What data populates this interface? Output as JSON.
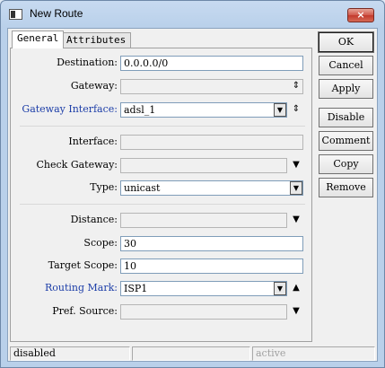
{
  "window": {
    "title": "New Route",
    "close_icon": "×"
  },
  "tabs": [
    {
      "label": "General"
    },
    {
      "label": "Attributes"
    }
  ],
  "fields": {
    "destination": {
      "label": "Destination:",
      "value": "0.0.0.0/0"
    },
    "gateway": {
      "label": "Gateway:",
      "value": ""
    },
    "gateway_interface": {
      "label": "Gateway Interface:",
      "value": "adsl_1"
    },
    "interface": {
      "label": "Interface:",
      "value": ""
    },
    "check_gateway": {
      "label": "Check Gateway:",
      "value": ""
    },
    "type": {
      "label": "Type:",
      "value": "unicast"
    },
    "distance": {
      "label": "Distance:",
      "value": ""
    },
    "scope": {
      "label": "Scope:",
      "value": "30"
    },
    "target_scope": {
      "label": "Target Scope:",
      "value": "10"
    },
    "routing_mark": {
      "label": "Routing Mark:",
      "value": "ISP1"
    },
    "pref_source": {
      "label": "Pref. Source:",
      "value": ""
    }
  },
  "buttons": {
    "ok": "OK",
    "cancel": "Cancel",
    "apply": "Apply",
    "disable": "Disable",
    "comment": "Comment",
    "copy": "Copy",
    "remove": "Remove"
  },
  "status": {
    "left": "disabled",
    "middle": "",
    "right": "active"
  },
  "icons": {
    "dropdown": "▼",
    "updown": "⇕",
    "up": "▲",
    "down": "▼"
  },
  "colors": {
    "blue_label": "#1d3ea8",
    "title_bar": "#b9d0ea"
  }
}
